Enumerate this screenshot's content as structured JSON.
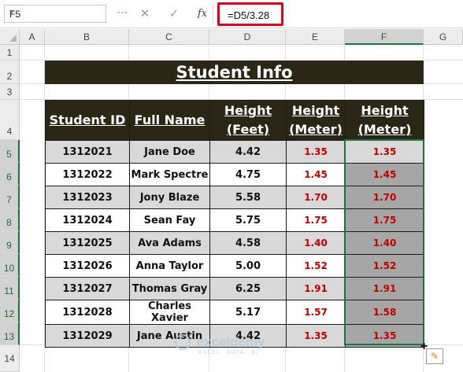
{
  "name_box": "F5",
  "formula": "=D5/3.28",
  "formula_bar": {
    "fx_label": "fx"
  },
  "columns": [
    "A",
    "B",
    "C",
    "D",
    "E",
    "F",
    "G"
  ],
  "rows": [
    "1",
    "2",
    "3",
    "4",
    "5",
    "6",
    "7",
    "8",
    "9",
    "10",
    "11",
    "12",
    "13",
    "14"
  ],
  "title": "Student Info",
  "table": {
    "headers": [
      "Student ID",
      "Full Name",
      "Height (Feet)",
      "Height (Meter)",
      "Height (Meter)"
    ],
    "rows": [
      [
        "1312021",
        "Jane Doe",
        "4.42",
        "1.35",
        "1.35"
      ],
      [
        "1312022",
        "Mark Spectre",
        "4.75",
        "1.45",
        "1.45"
      ],
      [
        "1312023",
        "Jony Blaze",
        "5.58",
        "1.70",
        "1.70"
      ],
      [
        "1312024",
        "Sean Fay",
        "5.75",
        "1.75",
        "1.75"
      ],
      [
        "1312025",
        "Ava Adams",
        "4.58",
        "1.40",
        "1.40"
      ],
      [
        "1312026",
        "Anna Taylor",
        "5.00",
        "1.52",
        "1.52"
      ],
      [
        "1312027",
        "Thomas Gray",
        "6.25",
        "1.91",
        "1.91"
      ],
      [
        "1312028",
        "Charles Xavier",
        "5.17",
        "1.57",
        "1.58"
      ],
      [
        "1312029",
        "Jane Austin",
        "4.42",
        "1.35",
        "1.35"
      ]
    ]
  },
  "watermark": {
    "brand": "exceldemy",
    "tagline": "EXCEL · DATA · BI"
  },
  "colors": {
    "header_bg": "#2b2717",
    "value_red": "#c00000",
    "selection_green": "#1f7244"
  }
}
